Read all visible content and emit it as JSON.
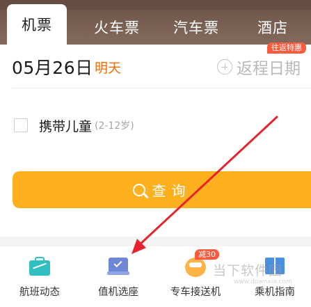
{
  "tabs": [
    {
      "label": "机票",
      "active": true
    },
    {
      "label": "火车票",
      "active": false
    },
    {
      "label": "汽车票",
      "active": false
    },
    {
      "label": "酒店",
      "active": false
    }
  ],
  "round_trip_badge": "往返特惠",
  "depart": {
    "date": "05月26日",
    "day": "明天"
  },
  "return_date": {
    "placeholder": "返程日期",
    "icon": "plus-circle-icon"
  },
  "child_option": {
    "label": "携带儿童",
    "range": "(2-12岁)",
    "checked": false
  },
  "search_button": {
    "label": "查询",
    "icon": "search-icon"
  },
  "services": [
    {
      "label": "航班动态",
      "icon": "briefcase-icon"
    },
    {
      "label": "值机选座",
      "icon": "checkin-monitor-icon"
    },
    {
      "label": "专车接送机",
      "icon": "car-icon",
      "badge": "减30"
    },
    {
      "label": "乘机指南",
      "icon": "book-icon"
    }
  ],
  "watermark": {
    "line1": "当下软件园",
    "line2": "www.downxia.com"
  },
  "colors": {
    "accent": "#ff6a00",
    "button": "#ffb01f",
    "badge": "#ff5a3c",
    "annotation_arrow": "#e8222a"
  }
}
